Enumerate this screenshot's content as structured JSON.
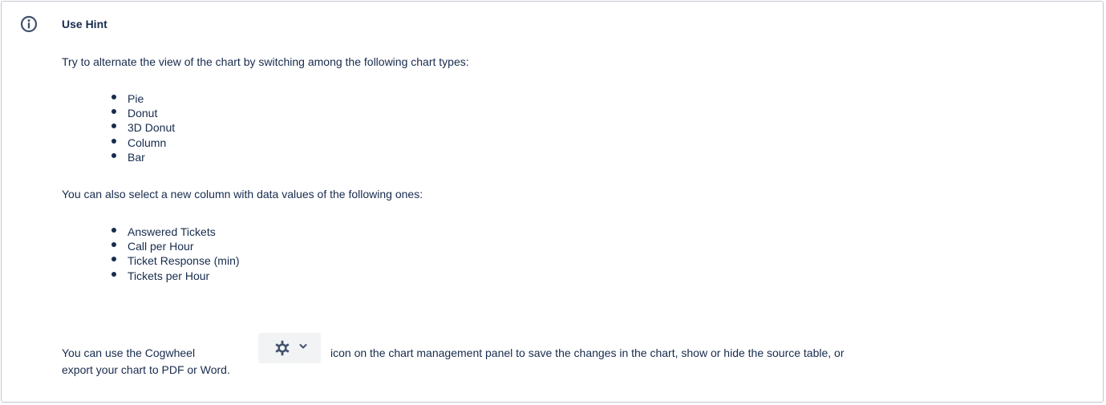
{
  "hint": {
    "icon": "info-icon",
    "title": "Use Hint",
    "intro": "Try to alternate the view of the chart by switching among the following chart types:",
    "chart_types": [
      "Pie",
      "Donut",
      "3D Donut",
      "Column",
      "Bar"
    ],
    "columns_intro": "You can also select a new column with data values of the following ones:",
    "columns": [
      "Answered Tickets",
      "Call per Hour",
      "Ticket Response (min)",
      "Tickets per Hour"
    ],
    "cog_before": "You can use the Cogwheel",
    "cog_after": "icon on the chart management panel to save the changes in the chart, show or hide the source table, or",
    "cog_line2": "export your chart to PDF or Word."
  },
  "colors": {
    "text": "#172b4d",
    "border": "#c1c7d0",
    "button_bg": "#f2f3f5",
    "icon": "#42526e"
  },
  "icons": {
    "cog": "gear-icon",
    "chevron": "chevron-down-icon"
  }
}
